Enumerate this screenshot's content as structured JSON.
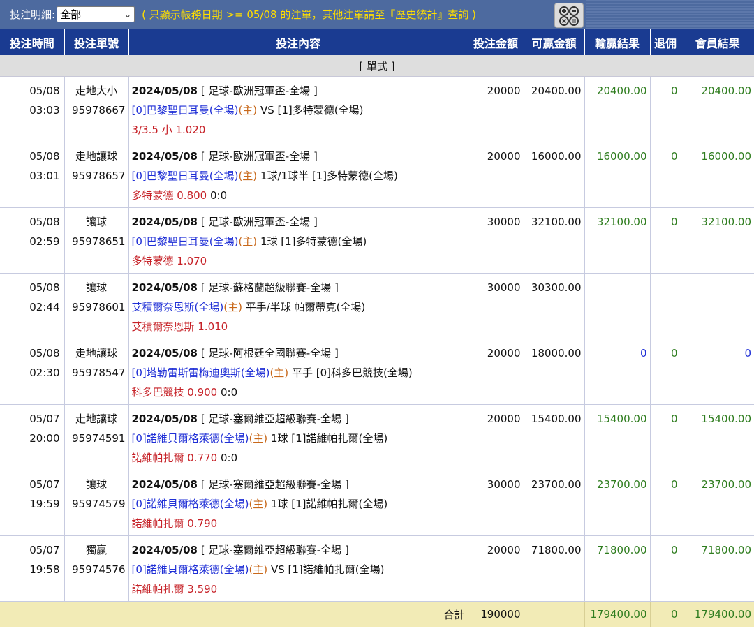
{
  "topbar": {
    "filter_label": "投注明細:",
    "filter_value": "全部",
    "notice": "( 只顯示帳務日期 >= 05/08 的注單，其他注單請至『歷史統計』查詢 )"
  },
  "table": {
    "headers": [
      "投注時間",
      "投注單號",
      "投注內容",
      "投注金額",
      "可贏金額",
      "輸贏結果",
      "退佣",
      "會員結果"
    ],
    "section_label": "[ 單式 ]",
    "rows": [
      {
        "date": "05/08",
        "time": "03:03",
        "type": "走地大小",
        "ticket": "95978667",
        "line1_date": "2024/05/08",
        "line1_league": "[ 足球-歐洲冠軍盃-全場 ]",
        "home": "[0]巴黎聖日耳曼(全場)",
        "home_tag": "(主)",
        "handicap": "VS",
        "away": "[1]多特蒙德(全場)",
        "pick": "3/3.5 小 1.020",
        "score": "",
        "stake": "20000",
        "win": "20400.00",
        "result": "20400.00",
        "rebate": "0",
        "member": "20400.00"
      },
      {
        "date": "05/08",
        "time": "03:01",
        "type": "走地讓球",
        "ticket": "95978657",
        "line1_date": "2024/05/08",
        "line1_league": "[ 足球-歐洲冠軍盃-全場 ]",
        "home": "[0]巴黎聖日耳曼(全場)",
        "home_tag": "(主)",
        "handicap": "1球/1球半",
        "away": "[1]多特蒙德(全場)",
        "pick": "多特蒙德 0.800",
        "score": "0:0",
        "stake": "20000",
        "win": "16000.00",
        "result": "16000.00",
        "rebate": "0",
        "member": "16000.00"
      },
      {
        "date": "05/08",
        "time": "02:59",
        "type": "讓球",
        "ticket": "95978651",
        "line1_date": "2024/05/08",
        "line1_league": "[ 足球-歐洲冠軍盃-全場 ]",
        "home": "[0]巴黎聖日耳曼(全場)",
        "home_tag": "(主)",
        "handicap": "1球",
        "away": "[1]多特蒙德(全場)",
        "pick": "多特蒙德 1.070",
        "score": "",
        "stake": "30000",
        "win": "32100.00",
        "result": "32100.00",
        "rebate": "0",
        "member": "32100.00"
      },
      {
        "date": "05/08",
        "time": "02:44",
        "type": "讓球",
        "ticket": "95978601",
        "line1_date": "2024/05/08",
        "line1_league": "[ 足球-蘇格蘭超級聯賽-全場 ]",
        "home": "艾積爾奈恩斯(全場)",
        "home_tag": "(主)",
        "handicap": "平手/半球",
        "away": "帕爾蒂克(全場)",
        "pick": "艾積爾奈恩斯 1.010",
        "score": "",
        "stake": "30000",
        "win": "30300.00",
        "result": "",
        "rebate": "",
        "member": ""
      },
      {
        "date": "05/08",
        "time": "02:30",
        "type": "走地讓球",
        "ticket": "95978547",
        "line1_date": "2024/05/08",
        "line1_league": "[ 足球-阿根廷全國聯賽-全場 ]",
        "home": "[0]塔勒雷斯雷梅迪奧斯(全場)",
        "home_tag": "(主)",
        "handicap": "平手",
        "away": "[0]科多巴競技(全場)",
        "pick": "科多巴競技 0.900",
        "score": "0:0",
        "stake": "20000",
        "win": "18000.00",
        "result": "0",
        "rebate": "0",
        "member": "0"
      },
      {
        "date": "05/07",
        "time": "20:00",
        "type": "走地讓球",
        "ticket": "95974591",
        "line1_date": "2024/05/08",
        "line1_league": "[ 足球-塞爾維亞超級聯賽-全場 ]",
        "home": "[0]諾維貝爾格萊德(全場)",
        "home_tag": "(主)",
        "handicap": "1球",
        "away": "[1]諾維帕扎爾(全場)",
        "pick": "諾維帕扎爾 0.770",
        "score": "0:0",
        "stake": "20000",
        "win": "15400.00",
        "result": "15400.00",
        "rebate": "0",
        "member": "15400.00"
      },
      {
        "date": "05/07",
        "time": "19:59",
        "type": "讓球",
        "ticket": "95974579",
        "line1_date": "2024/05/08",
        "line1_league": "[ 足球-塞爾維亞超級聯賽-全場 ]",
        "home": "[0]諾維貝爾格萊德(全場)",
        "home_tag": "(主)",
        "handicap": "1球",
        "away": "[1]諾維帕扎爾(全場)",
        "pick": "諾維帕扎爾 0.790",
        "score": "",
        "stake": "30000",
        "win": "23700.00",
        "result": "23700.00",
        "rebate": "0",
        "member": "23700.00"
      },
      {
        "date": "05/07",
        "time": "19:58",
        "type": "獨贏",
        "ticket": "95974576",
        "line1_date": "2024/05/08",
        "line1_league": "[ 足球-塞爾維亞超級聯賽-全場 ]",
        "home": "[0]諾維貝爾格萊德(全場)",
        "home_tag": "(主)",
        "handicap": "VS",
        "away": "[1]諾維帕扎爾(全場)",
        "pick": "諾維帕扎爾 3.590",
        "score": "",
        "stake": "20000",
        "win": "71800.00",
        "result": "71800.00",
        "rebate": "0",
        "member": "71800.00"
      }
    ],
    "total": {
      "label": "合計",
      "stake": "190000",
      "result": "179400.00",
      "rebate": "0",
      "member": "179400.00"
    }
  },
  "colors": {
    "header": "#1a3b91",
    "topbar": "#4d6a9f",
    "notice": "#ffde00",
    "positive": "#2f7d1f",
    "neutral": "#1f2fd6",
    "pick": "#c62026",
    "home_tag": "#c8681a",
    "total_bg": "#f2ebb6"
  },
  "icons": {
    "calc": "calculator-icon"
  }
}
